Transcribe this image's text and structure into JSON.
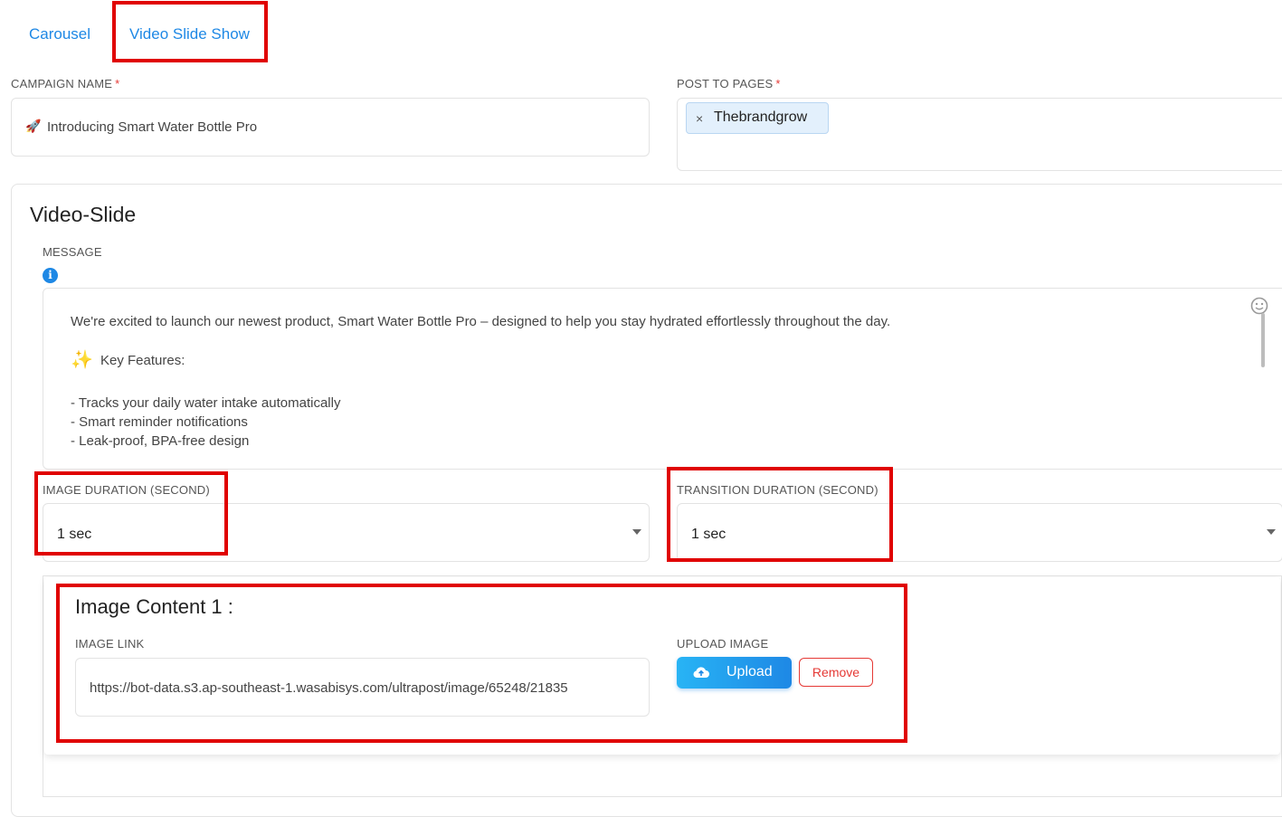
{
  "tabs": [
    {
      "label": "Carousel"
    },
    {
      "label": "Video Slide Show"
    }
  ],
  "campaign": {
    "label": "CAMPAIGN NAME",
    "required_mark": "*",
    "emoji": "🚀",
    "value": "Introducing Smart Water Bottle Pro"
  },
  "pages": {
    "label": "POST TO PAGES",
    "required_mark": "*",
    "chips": [
      {
        "remove_glyph": "×",
        "label": "Thebrandgrow"
      }
    ]
  },
  "section": {
    "title": "Video-Slide",
    "message_label": "MESSAGE",
    "info_glyph": "i",
    "message_lines": [
      "We're excited to launch our newest product, Smart Water Bottle Pro – designed to help you stay hydrated effortlessly throughout the day.",
      "Key Features:",
      "- Tracks your daily water intake automatically",
      "- Smart reminder notifications",
      "- Leak-proof, BPA-free design"
    ],
    "sparkle_emoji": "✨",
    "emoji_picker_icon": "smiley-icon"
  },
  "image_duration": {
    "label": "IMAGE DURATION (SECOND)",
    "value": "1 sec"
  },
  "transition_duration": {
    "label": "TRANSITION DURATION (SECOND)",
    "value": "1 sec"
  },
  "image_content": {
    "title": "Image Content 1 :",
    "link_label": "IMAGE LINK",
    "link_value": "https://bot-data.s3.ap-southeast-1.wasabisys.com/ultrapost/image/65248/21835",
    "upload_label": "UPLOAD IMAGE",
    "upload_button": "Upload",
    "remove_button": "Remove"
  },
  "colors": {
    "accent": "#1e88e5",
    "highlight": "#e00000",
    "remove": "#e53935",
    "chip_bg": "#e3f0fc"
  }
}
